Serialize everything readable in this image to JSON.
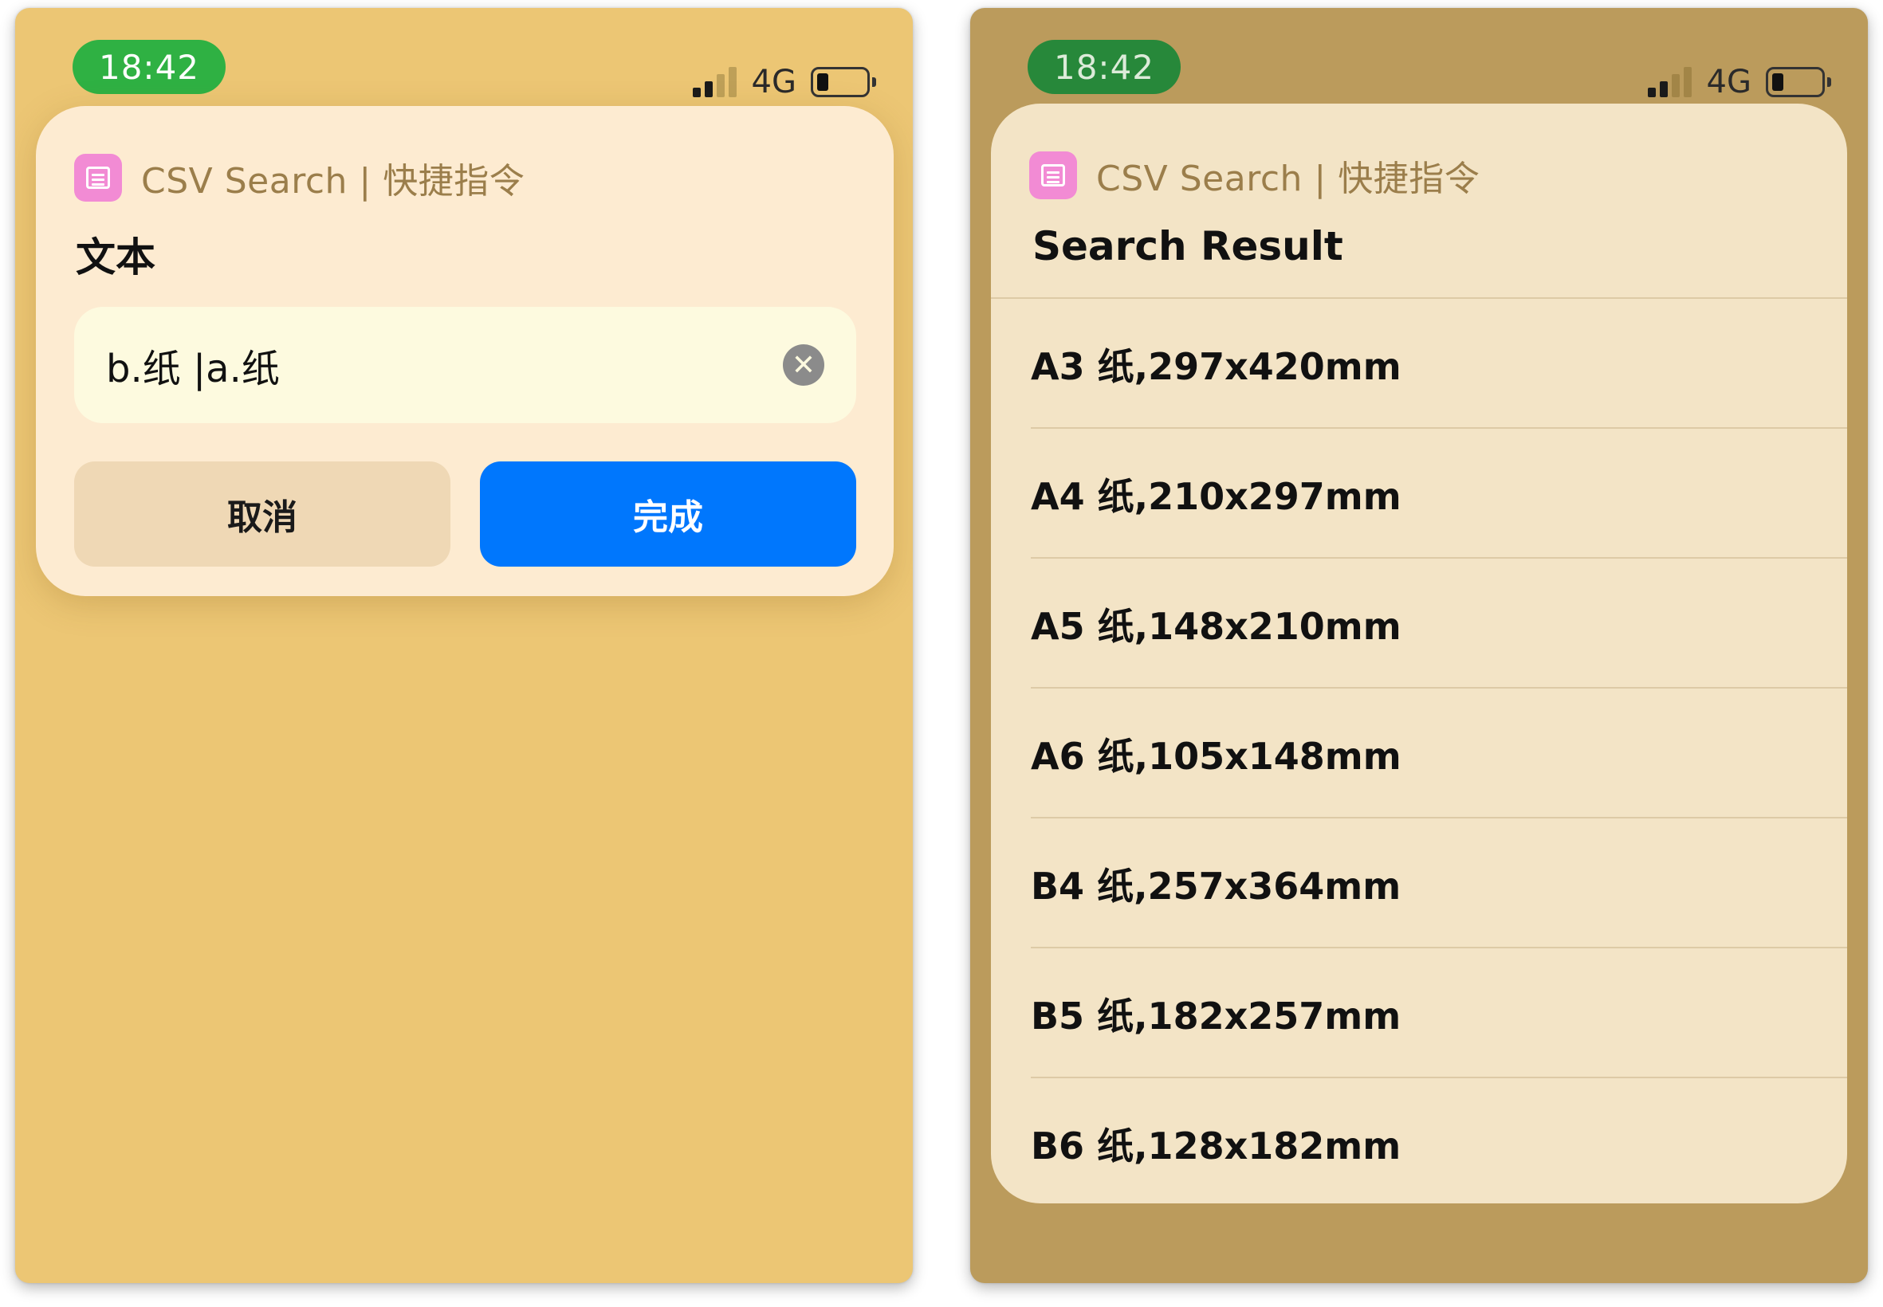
{
  "left_screen": {
    "status": {
      "time": "18:42",
      "network": "4G"
    },
    "dialog": {
      "app_name": "CSV Search | 快捷指令",
      "prompt_label": "文本",
      "input_value": "b.纸 |a.纸",
      "cancel_label": "取消",
      "done_label": "完成"
    }
  },
  "right_screen": {
    "status": {
      "time": "18:42",
      "network": "4G"
    },
    "result": {
      "app_name": "CSV Search | 快捷指令",
      "title": "Search Result",
      "items": [
        "A3 纸,297x420mm",
        "A4 纸,210x297mm",
        "A5 纸,148x210mm",
        "A6 纸,105x148mm",
        "B4 纸,257x364mm",
        "B5 纸,182x257mm",
        "B6 纸,128x182mm"
      ]
    }
  },
  "colors": {
    "accent": "#0077fd",
    "app_icon": "#f28bd4",
    "time_pill": "#2fb143"
  },
  "icons": [
    "clear-icon",
    "signal-icon",
    "battery-icon",
    "app-icon"
  ]
}
